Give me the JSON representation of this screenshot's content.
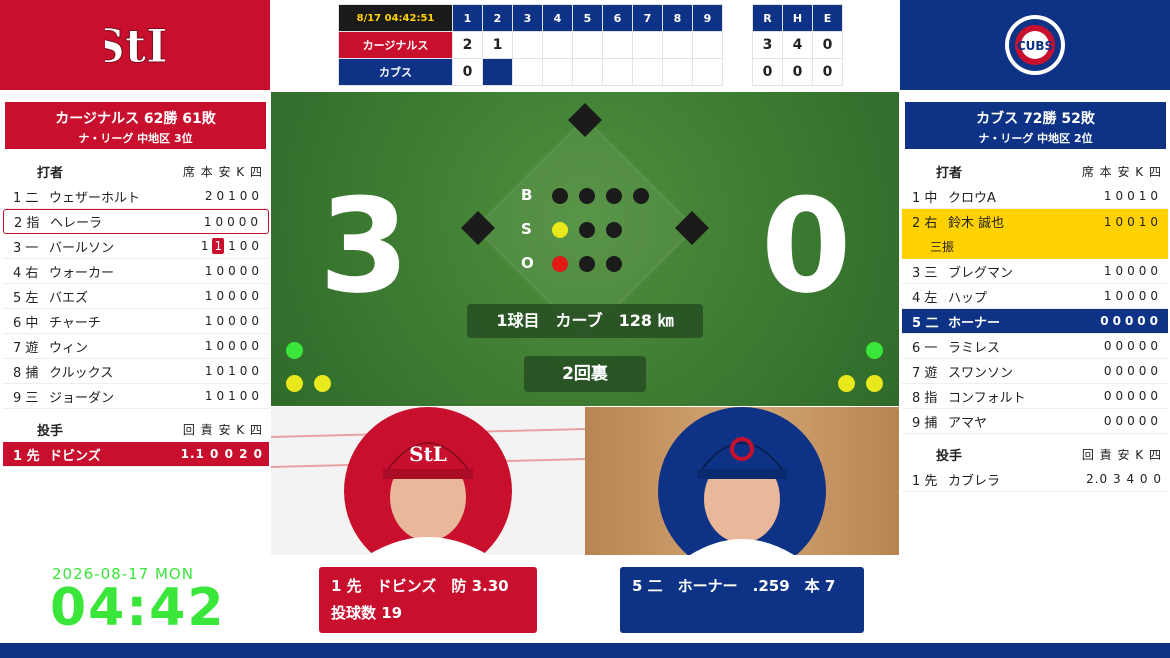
{
  "colors": {
    "cardinals_red": "#c8102e",
    "cubs_blue": "#0e3386",
    "highlight_yellow": "#ffd200",
    "clock_green": "#39e639"
  },
  "scoreboard": {
    "clock": "8/17 04:42:51",
    "innings": [
      "1",
      "2",
      "3",
      "4",
      "5",
      "6",
      "7",
      "8",
      "9"
    ],
    "rhe_headers": [
      "R",
      "H",
      "E"
    ],
    "teams": [
      {
        "name": "カージナルス",
        "innings": [
          "2",
          "1",
          "",
          "",
          "",
          "",
          "",
          "",
          ""
        ],
        "rhe": [
          "3",
          "4",
          "0"
        ]
      },
      {
        "name": "カブス",
        "innings": [
          "0",
          "",
          "",
          "",
          "",
          "",
          "",
          "",
          ""
        ],
        "rhe": [
          "0",
          "0",
          "0"
        ]
      }
    ]
  },
  "logos": {
    "away": "stl-logo-icon",
    "home": "cubs-logo-icon",
    "home_text": "CUBS"
  },
  "away": {
    "title": "カージナルス 62勝 61敗",
    "subtitle": "ナ・リーグ 中地区 3位",
    "batter_header": "打者",
    "stat_headers": "席 本 安 K 四",
    "batters": [
      {
        "pos": "1 二",
        "name": "ウェザーホルト",
        "stats": "20100"
      },
      {
        "pos": "2 指",
        "name": "ヘレーラ",
        "stats": "10000"
      },
      {
        "pos": "3 一",
        "name": "バールソン",
        "stats_a": "1",
        "stats_hr": "1",
        "stats_b": "100"
      },
      {
        "pos": "4 右",
        "name": "ウォーカー",
        "stats": "10000"
      },
      {
        "pos": "5 左",
        "name": "バエズ",
        "stats": "10000"
      },
      {
        "pos": "6 中",
        "name": "チャーチ",
        "stats": "10000"
      },
      {
        "pos": "7 遊",
        "name": "ウィン",
        "stats": "10000"
      },
      {
        "pos": "8 捕",
        "name": "クルックス",
        "stats": "10100"
      },
      {
        "pos": "9 三",
        "name": "ジョーダン",
        "stats": "10100"
      }
    ],
    "pitcher_header": "投手",
    "pitcher_stat_headers": "回 責 安 K 四",
    "pitchers": [
      {
        "pos": "1 先",
        "name": "ドビンズ",
        "stats": "1.1 0 0 2 0"
      }
    ]
  },
  "home": {
    "title": "カブス 72勝 52敗",
    "subtitle": "ナ・リーグ 中地区 2位",
    "batter_header": "打者",
    "stat_headers": "席 本 安 K 四",
    "batters": [
      {
        "pos": "1 中",
        "name": "クロウA",
        "stats": "10010"
      },
      {
        "pos": "2 右",
        "name": "鈴木 誠也",
        "stats": "10010",
        "note": "三振"
      },
      {
        "pos": "3 三",
        "name": "ブレグマン",
        "stats": "10000"
      },
      {
        "pos": "4 左",
        "name": "ハップ",
        "stats": "10000"
      },
      {
        "pos": "5 二",
        "name": "ホーナー",
        "stats": "00000"
      },
      {
        "pos": "6 一",
        "name": "ラミレス",
        "stats": "00000"
      },
      {
        "pos": "7 遊",
        "name": "スワンソン",
        "stats": "00000"
      },
      {
        "pos": "8 指",
        "name": "コンフォルト",
        "stats": "00000"
      },
      {
        "pos": "9 捕",
        "name": "アマヤ",
        "stats": "00000"
      }
    ],
    "pitcher_header": "投手",
    "pitcher_stat_headers": "回 責 安 K 四",
    "pitchers": [
      {
        "pos": "1 先",
        "name": "カブレラ",
        "stats": "2.0 3 4 0 0"
      }
    ]
  },
  "field": {
    "away_score": "3",
    "home_score": "0",
    "count": {
      "b_label": "B",
      "s_label": "S",
      "o_label": "O",
      "balls": 0,
      "strikes": 1,
      "outs": 1
    },
    "pitch_info": "1球目　カーブ　128 ㎞",
    "inning": "2回裏"
  },
  "pitcher_card": {
    "line1": "1 先　ドビンズ　防 3.30",
    "line2": "投球数 19"
  },
  "batter_card": {
    "line1": "5 二　ホーナー　.259　本 7"
  },
  "clock": {
    "date": "2026-08-17 MON",
    "time": "04:42"
  }
}
